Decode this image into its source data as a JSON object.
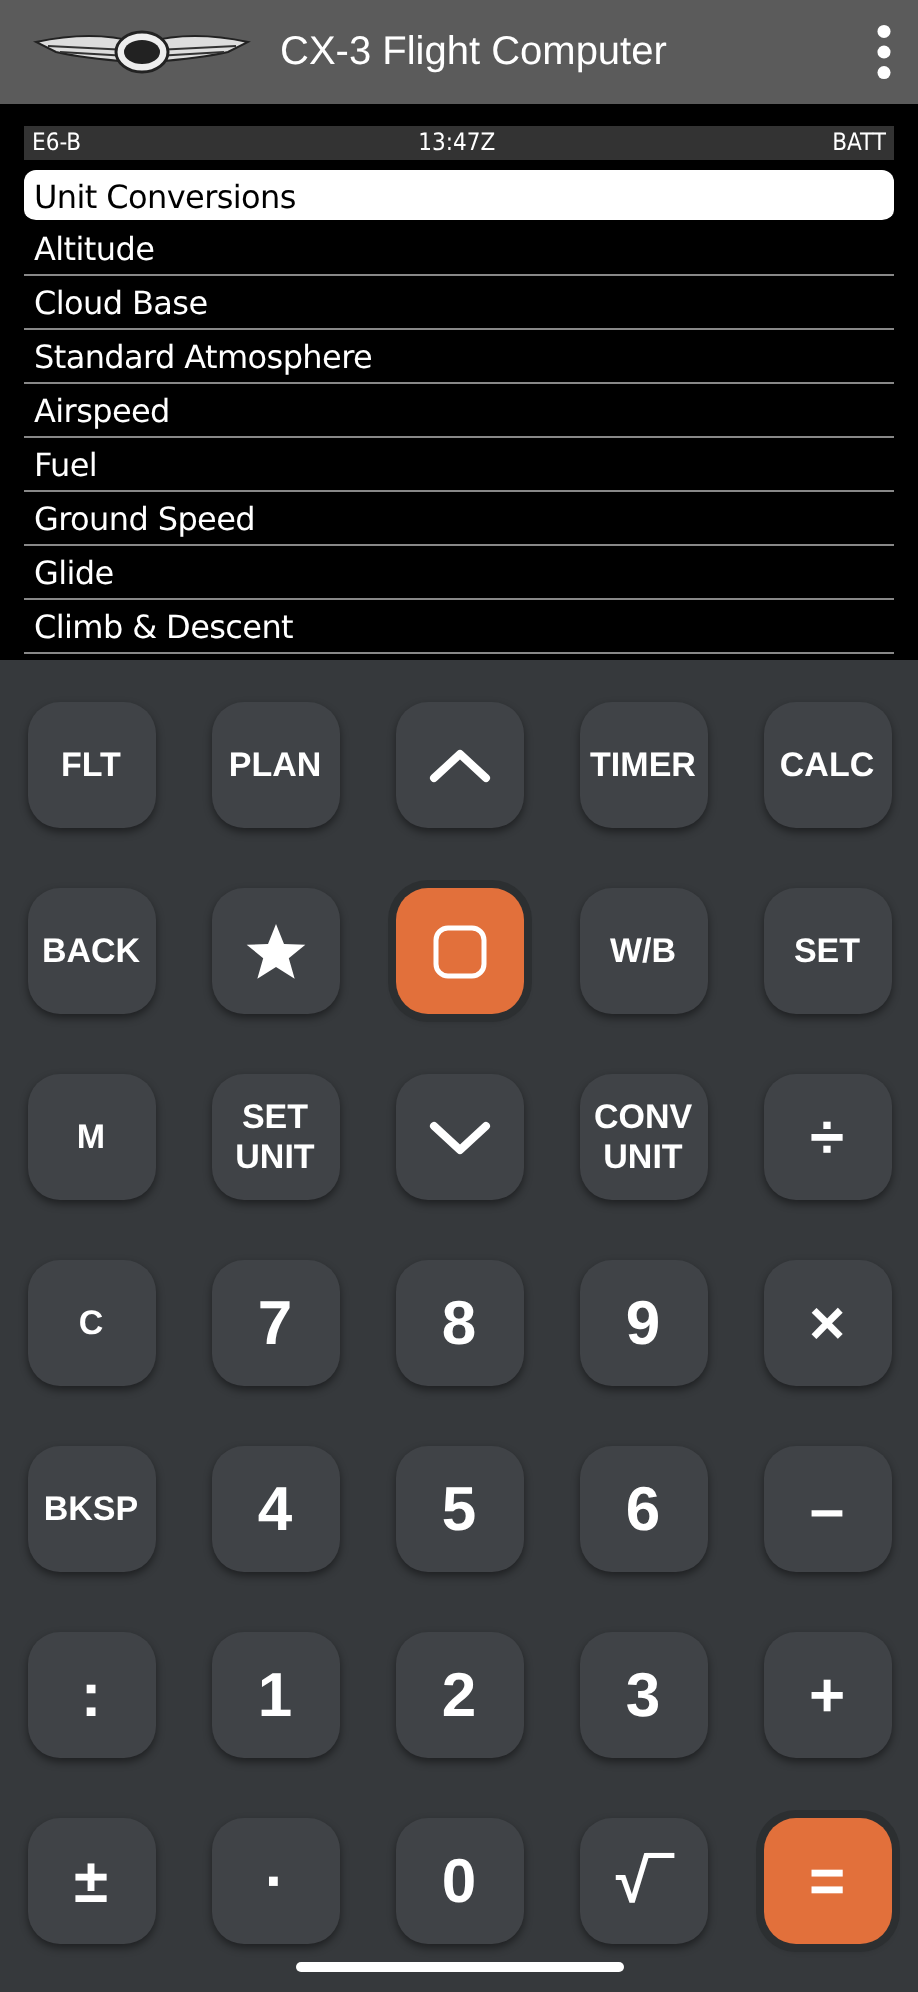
{
  "app_bar": {
    "title": "CX-3 Flight Computer"
  },
  "status": {
    "mode": "E6-B",
    "time": "13:47Z",
    "battery": "BATT"
  },
  "menu": [
    {
      "label": "Unit Conversions",
      "selected": true
    },
    {
      "label": "Altitude",
      "selected": false
    },
    {
      "label": "Cloud Base",
      "selected": false
    },
    {
      "label": "Standard Atmosphere",
      "selected": false
    },
    {
      "label": "Airspeed",
      "selected": false
    },
    {
      "label": "Fuel",
      "selected": false
    },
    {
      "label": "Ground Speed",
      "selected": false
    },
    {
      "label": "Glide",
      "selected": false
    },
    {
      "label": "Climb & Descent",
      "selected": false
    }
  ],
  "keys": [
    {
      "kind": "text",
      "label": "FLT",
      "accent": false
    },
    {
      "kind": "text",
      "label": "PLAN",
      "accent": false
    },
    {
      "kind": "up",
      "accent": false
    },
    {
      "kind": "text",
      "label": "TIMER",
      "accent": false
    },
    {
      "kind": "text",
      "label": "CALC",
      "accent": false
    },
    {
      "kind": "text",
      "label": "BACK",
      "accent": false
    },
    {
      "kind": "star",
      "accent": false
    },
    {
      "kind": "stop",
      "accent": true
    },
    {
      "kind": "text",
      "label": "W/B",
      "accent": false
    },
    {
      "kind": "text",
      "label": "SET",
      "accent": false
    },
    {
      "kind": "text",
      "label": "M",
      "accent": false
    },
    {
      "kind": "text",
      "label": "SET\nUNIT",
      "accent": false
    },
    {
      "kind": "down",
      "accent": false
    },
    {
      "kind": "text",
      "label": "CONV\nUNIT",
      "accent": false
    },
    {
      "kind": "big",
      "label": "÷",
      "accent": false
    },
    {
      "kind": "text",
      "label": "C",
      "accent": false
    },
    {
      "kind": "big",
      "label": "7",
      "accent": false
    },
    {
      "kind": "big",
      "label": "8",
      "accent": false
    },
    {
      "kind": "big",
      "label": "9",
      "accent": false
    },
    {
      "kind": "big",
      "label": "×",
      "accent": false
    },
    {
      "kind": "text",
      "label": "BKSP",
      "accent": false
    },
    {
      "kind": "big",
      "label": "4",
      "accent": false
    },
    {
      "kind": "big",
      "label": "5",
      "accent": false
    },
    {
      "kind": "big",
      "label": "6",
      "accent": false
    },
    {
      "kind": "big",
      "label": "–",
      "accent": false
    },
    {
      "kind": "big",
      "label": ":",
      "accent": false
    },
    {
      "kind": "big",
      "label": "1",
      "accent": false
    },
    {
      "kind": "big",
      "label": "2",
      "accent": false
    },
    {
      "kind": "big",
      "label": "3",
      "accent": false
    },
    {
      "kind": "big",
      "label": "+",
      "accent": false
    },
    {
      "kind": "big",
      "label": "±",
      "accent": false
    },
    {
      "kind": "big",
      "label": "·",
      "accent": false
    },
    {
      "kind": "big",
      "label": "0",
      "accent": false
    },
    {
      "kind": "big",
      "label": "√‾",
      "accent": false
    },
    {
      "kind": "big",
      "label": "=",
      "accent": true
    }
  ]
}
